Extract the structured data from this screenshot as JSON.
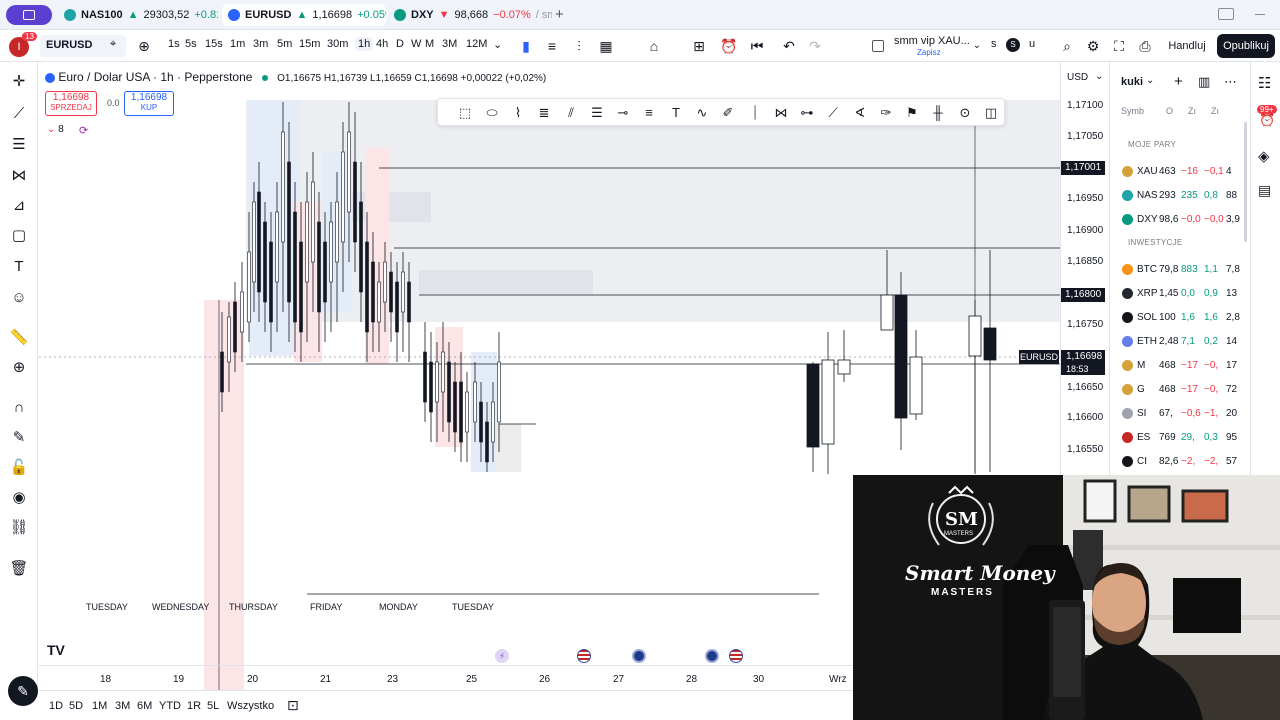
{
  "tabs": [
    {
      "symbol": "NAS100",
      "arrow": "▲",
      "price": "29303,52",
      "change": "+0.81",
      "direction": "up",
      "icon_color": "#1ea5a8"
    },
    {
      "symbol": "EURUSD",
      "arrow": "▲",
      "price": "1,16698",
      "change": "+0.05%",
      "direction": "up",
      "icon_color": "#2962ff"
    },
    {
      "symbol": "DXY",
      "arrow": "▼",
      "price": "98,668",
      "change": "−0.07%",
      "suffix": "/ sm",
      "direction": "down",
      "icon_color": "#089981"
    }
  ],
  "new_tab": "+",
  "toolbar": {
    "notifications_badge": "13",
    "symbol": "EURUSD",
    "intervals": [
      "1s",
      "5s",
      "15s",
      "1m",
      "3m",
      "5m",
      "15m",
      "30m",
      "1h",
      "4h",
      "D",
      "W",
      "M",
      "3M",
      "12M"
    ],
    "active_interval": "1h",
    "layout_name": "smm vip XAU...",
    "layout_sub": "Zapisz",
    "trade_label": "Handluj",
    "publish_label": "Opublikuj"
  },
  "legend": {
    "title": "Euro / Dolar USA · 1h · Pepperstone",
    "ohlc": "O1,16675 H1,16739 L1,16659 C1,16698 +0,00022 (+0,02%)",
    "sell_price": "1,16698",
    "sell_label": "SPRZEDAJ",
    "spread": "0.0",
    "buy_price": "1,16698",
    "buy_label": "KUP",
    "indicators_count": "8"
  },
  "price_axis": {
    "currency": "USD",
    "labels": [
      "1,17100",
      "1,17050",
      "1,16950",
      "1,16900",
      "1,16850",
      "1,16750",
      "1,16650",
      "1,16600",
      "1,16550"
    ],
    "boxed": [
      {
        "label": "1,17001"
      },
      {
        "label": "1,16800"
      }
    ],
    "current": {
      "symbol": "EURUSD",
      "price": "1,16698",
      "countdown": "18:53"
    }
  },
  "time_labels_days": [
    "TUESDAY",
    "WEDNESDAY",
    "THURSDAY",
    "FRIDAY",
    "MONDAY",
    "TUESDAY"
  ],
  "time_axis": [
    "18",
    "19",
    "20",
    "21",
    "23",
    "25",
    "26",
    "27",
    "28",
    "30",
    "Wrz"
  ],
  "bottom_ranges": [
    "1D",
    "5D",
    "1M",
    "3M",
    "6M",
    "YTD",
    "1R",
    "5L",
    "Wszystko"
  ],
  "watchlist": {
    "name": "kuki",
    "columns": [
      "Symb",
      "O",
      "Zı",
      "Zı"
    ],
    "sections": [
      {
        "title": "MOJE PARY",
        "rows": [
          {
            "sym": "XAU",
            "last": "463",
            "chg": "−16",
            "pct": "−0,1",
            "extra": "4",
            "color": "#d4a23a",
            "dir": "down"
          },
          {
            "sym": "NAS",
            "last": "293",
            "chg": "235",
            "pct": "0,8",
            "extra": "88",
            "color": "#1ea5a8",
            "dir": "up"
          },
          {
            "sym": "DXY",
            "last": "98,6",
            "chg": "−0,0",
            "pct": "−0,0",
            "extra": "3,9",
            "color": "#089981",
            "dir": "down"
          }
        ]
      },
      {
        "title": "INWESTYCJE",
        "rows": [
          {
            "sym": "BTC",
            "last": "79,8",
            "chg": "883",
            "pct": "1,1",
            "extra": "7,8",
            "color": "#f7931a",
            "dir": "up"
          },
          {
            "sym": "XRP",
            "last": "1,45",
            "chg": "0,0",
            "pct": "0,9",
            "extra": "13",
            "color": "#23292f",
            "dir": "up"
          },
          {
            "sym": "SOL",
            "last": "100",
            "chg": "1,6",
            "pct": "1,6",
            "extra": "2,8",
            "color": "#14151a",
            "dir": "up"
          },
          {
            "sym": "ETH",
            "last": "2,48",
            "chg": "7,1",
            "pct": "0,2",
            "extra": "14",
            "color": "#627eea",
            "dir": "up"
          },
          {
            "sym": "M",
            "last": "468",
            "chg": "−17",
            "pct": "−0,",
            "extra": "17",
            "color": "#d4a23a",
            "dir": "down"
          },
          {
            "sym": "G",
            "last": "468",
            "chg": "−17",
            "pct": "−0,",
            "extra": "72",
            "color": "#d4a23a",
            "dir": "down"
          },
          {
            "sym": "SI",
            "last": "67,",
            "chg": "−0,6",
            "pct": "−1,",
            "extra": "20",
            "color": "#a0a3ab",
            "dir": "down"
          },
          {
            "sym": "ES",
            "last": "769",
            "chg": "29,",
            "pct": "0,3",
            "extra": "95",
            "color": "#c62828",
            "dir": "up"
          },
          {
            "sym": "CI",
            "last": "82,6",
            "chg": "−2,",
            "pct": "−2,",
            "extra": "57",
            "color": "#14151a",
            "dir": "down"
          }
        ]
      }
    ]
  },
  "right_badge": "99+",
  "webcam": {
    "brand_top": "SM",
    "brand_sub": "MASTERS",
    "brand_script": "Smart Money",
    "brand_bottom": "MASTERS"
  },
  "colors": {
    "up": "#089981",
    "down": "#f23645",
    "accent": "#2962ff",
    "brand_red": "#e53935"
  }
}
